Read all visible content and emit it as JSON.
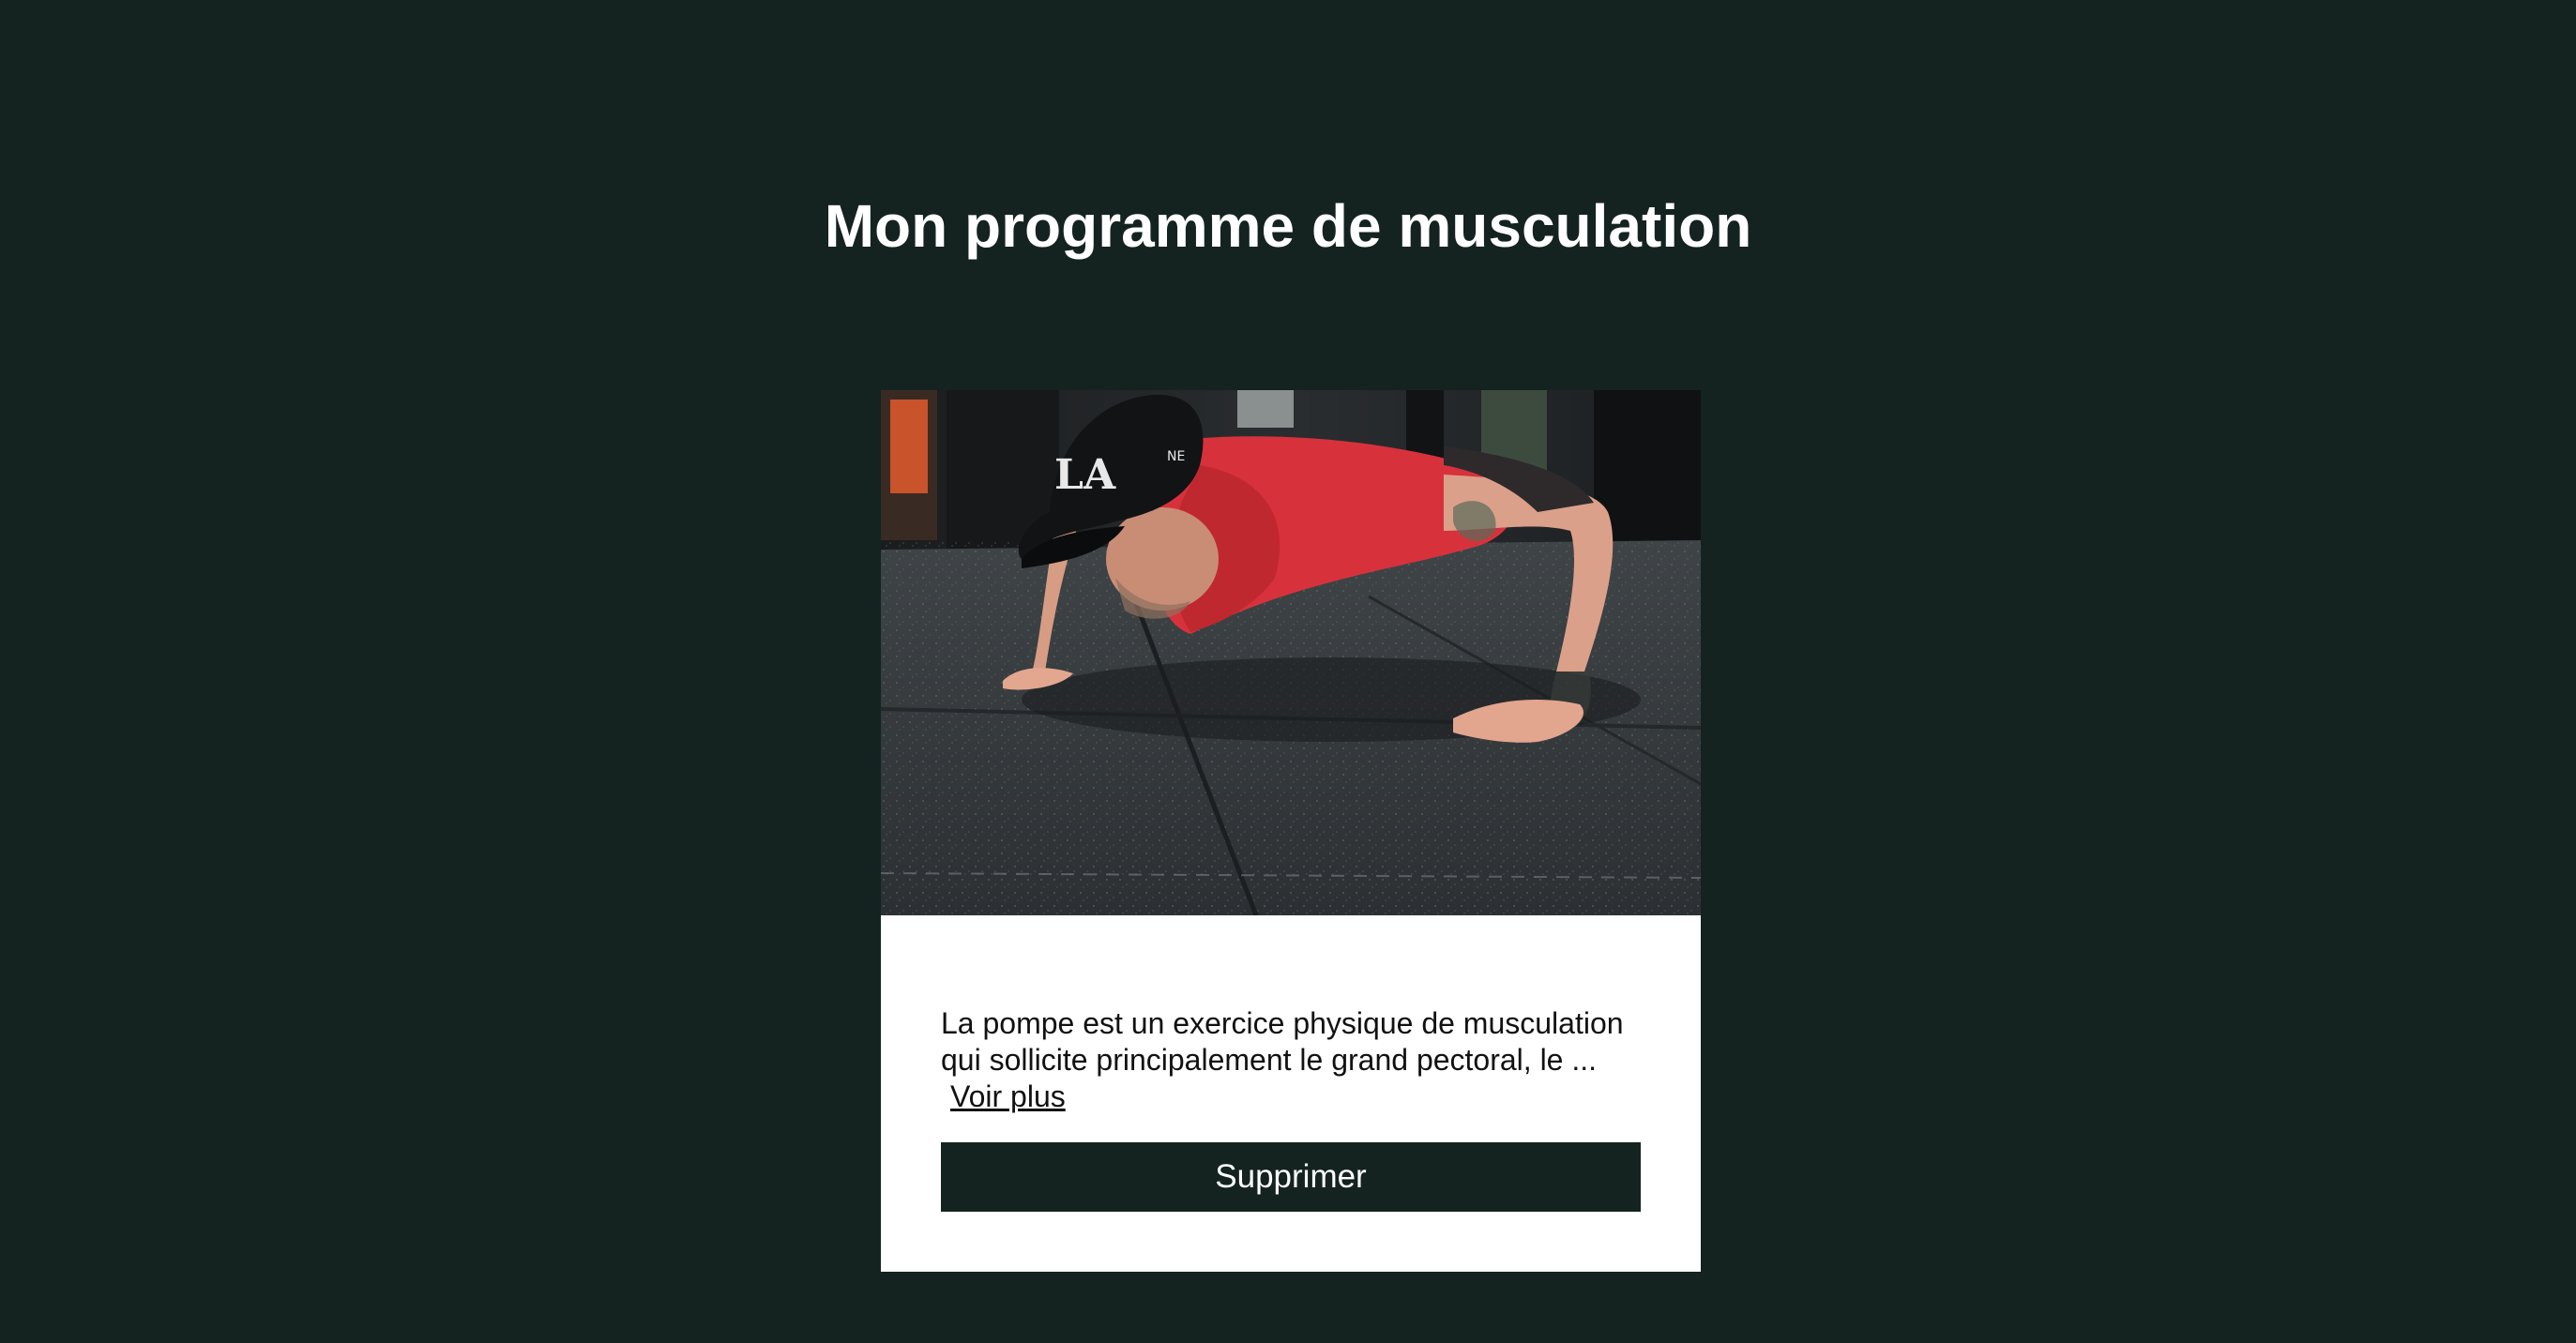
{
  "page": {
    "title": "Mon programme de musculation"
  },
  "card": {
    "image_alt": "Homme faisant des pompes dans une salle de sport",
    "description": "La pompe est un exercice physique de musculation qui sollicite principalement le grand pectoral, le ...",
    "see_more_label": "Voir plus",
    "delete_label": "Supprimer"
  },
  "colors": {
    "background": "#142320",
    "card": "#ffffff",
    "button": "#142320",
    "button_text": "#ffffff"
  }
}
